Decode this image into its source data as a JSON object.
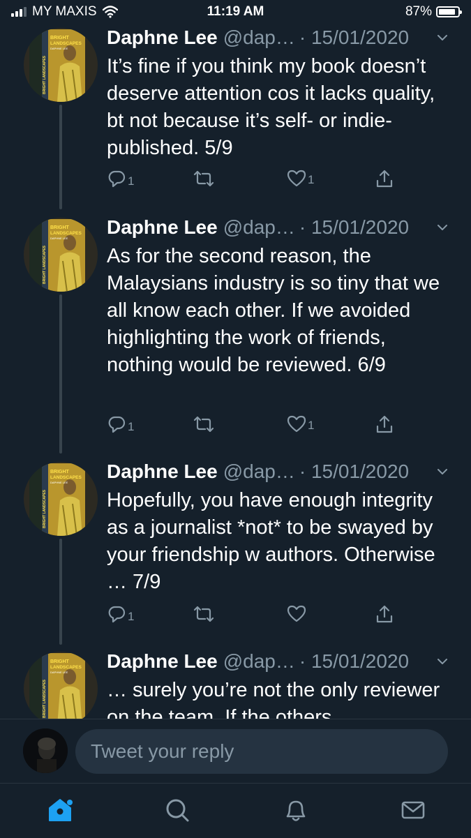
{
  "status_bar": {
    "carrier": "MY MAXIS",
    "time": "11:19 AM",
    "battery_percent": "87%",
    "battery_level": 0.87
  },
  "tweets": [
    {
      "name": "Daphne Lee",
      "handle": "@dap…",
      "date": "· 15/01/2020",
      "text": "It’s fine if you think my book doesn’t deserve attention cos it lacks quality, bt not because it’s self- or indie-published. 5/9",
      "reply_count": "1",
      "retweet_count": "",
      "like_count": "1"
    },
    {
      "name": "Daphne Lee",
      "handle": "@dap…",
      "date": "· 15/01/2020",
      "text": "As for the second reason, the Malaysians industry is so tiny that we all know each other. If we avoided highlighting the work of friends, nothing would be reviewed. 6/9",
      "reply_count": "1",
      "retweet_count": "",
      "like_count": "1"
    },
    {
      "name": "Daphne Lee",
      "handle": "@dap…",
      "date": "· 15/01/2020",
      "text": "Hopefully, you have enough integrity as a journalist *not* to be swayed by your friendship w authors. Otherwise … 7/9",
      "reply_count": "1",
      "retweet_count": "",
      "like_count": ""
    },
    {
      "name": "Daphne Lee",
      "handle": "@dap…",
      "date": "· 15/01/2020",
      "text": "… surely you’re not the only reviewer on the team. If the others",
      "reply_count": "",
      "retweet_count": "",
      "like_count": ""
    }
  ],
  "avatar_book": {
    "title_line1": "BRIGHT",
    "title_line2": "LANDSCAPES",
    "author": "DAPHNE LEE"
  },
  "reply_bar": {
    "placeholder": "Tweet your reply"
  },
  "tab_bar": {
    "items": [
      "home-icon",
      "search-icon",
      "notifications-icon",
      "messages-icon"
    ],
    "active": "home-icon"
  },
  "colors": {
    "background": "#15202b",
    "secondary_text": "#8899a6",
    "accent": "#1da1f2"
  }
}
